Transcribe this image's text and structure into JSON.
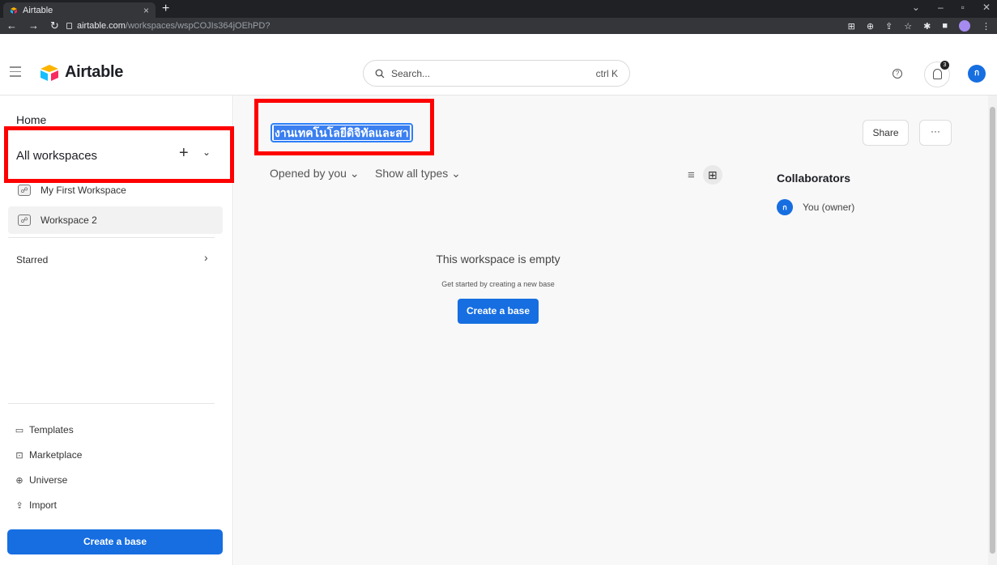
{
  "browser": {
    "tab_title": "Airtable",
    "tab_close": "×",
    "new_tab": "+",
    "url_domain": "airtable.com",
    "url_path": "/workspaces/wspCOJIs364jOEhPD?",
    "window_controls": [
      "⌄",
      "–",
      "▫",
      "✕"
    ]
  },
  "header": {
    "logo_text": "Airtable",
    "search_placeholder": "Search...",
    "search_hint": "ctrl K",
    "notification_count": "3",
    "user_initial": "ก"
  },
  "sidebar": {
    "home": "Home",
    "all_workspaces": "All workspaces",
    "workspaces": [
      "My First Workspace",
      "Workspace 2"
    ],
    "starred": "Starred",
    "links": [
      "Templates",
      "Marketplace",
      "Universe",
      "Import"
    ],
    "create_base": "Create a base"
  },
  "main": {
    "workspace_name": "งานเทคโนโลยีดิจิทัลและสา",
    "filter_opened": "Opened by you",
    "filter_types": "Show all types",
    "empty_title": "This workspace is empty",
    "empty_subtitle": "Get started by creating a new base",
    "create_base": "Create a base",
    "share": "Share",
    "more": "···",
    "collaborators_title": "Collaborators",
    "collaborator_initial": "ก",
    "collaborator_name": "You (owner)"
  },
  "colors": {
    "accent": "#166ee1",
    "highlight_box": "#ff0000"
  }
}
